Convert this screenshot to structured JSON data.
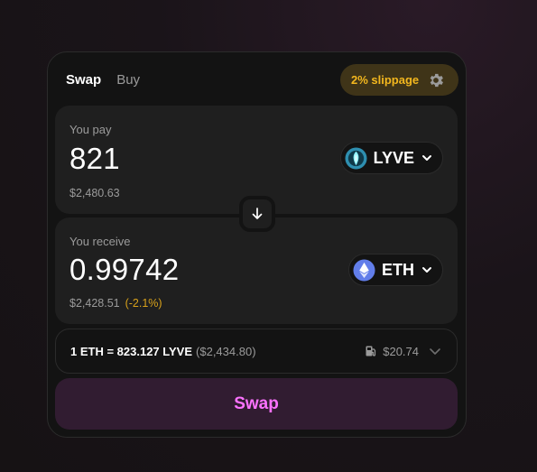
{
  "tabs": [
    {
      "label": "Swap",
      "active": true
    },
    {
      "label": "Buy",
      "active": false
    }
  ],
  "slippage": {
    "label": "2% slippage",
    "icon": "gear-icon"
  },
  "pay": {
    "label": "You pay",
    "amount": "821",
    "usd": "$2,480.63",
    "token": {
      "symbol": "LYVE",
      "icon": "lyve-token-icon"
    }
  },
  "receive": {
    "label": "You receive",
    "amount": "0.99742",
    "usd": "$2,428.51",
    "price_impact": "(-2.1%)",
    "token": {
      "symbol": "ETH",
      "icon": "eth-token-icon"
    }
  },
  "rate": {
    "text": "1 ETH = 823.127 LYVE",
    "usd": "($2,434.80)",
    "gas": "$20.74",
    "gas_icon": "gas-pump-icon"
  },
  "swap_button": {
    "label": "Swap"
  },
  "colors": {
    "accent": "#fc72ff",
    "accent_bg": "#311c31",
    "warning": "#f3b71e",
    "impact": "#d9a21b"
  }
}
